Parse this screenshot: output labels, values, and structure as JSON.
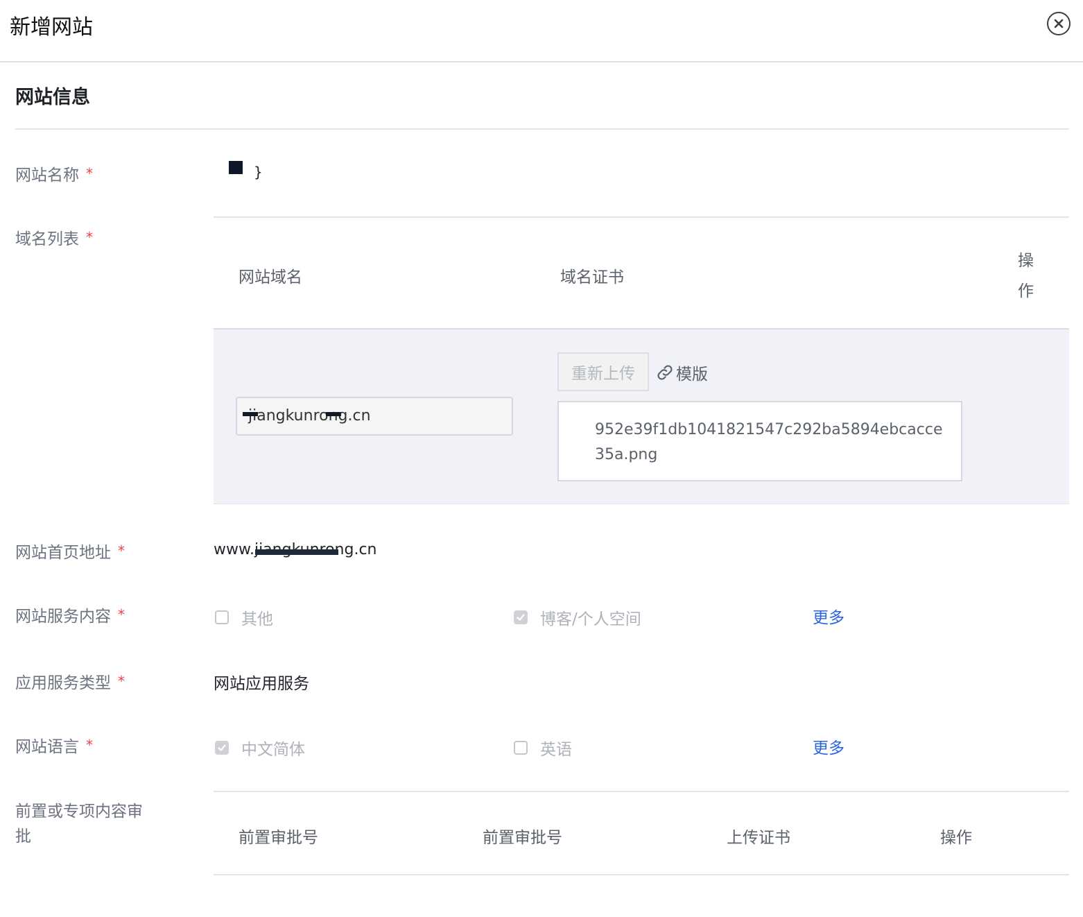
{
  "dialog": {
    "title": "新增网站"
  },
  "section": {
    "title": "网站信息"
  },
  "fields": {
    "site_name": {
      "label": "网站名称",
      "required_mark": "*",
      "value_glyph": "}"
    },
    "domain_list": {
      "label": "域名列表",
      "required_mark": "*",
      "columns": {
        "domain": "网站域名",
        "certificate": "域名证书",
        "ops_line1": "操",
        "ops_line2": "作"
      },
      "rows": [
        {
          "domain": "jiangkunrong.cn",
          "reupload_label": "重新上传",
          "template_label": "模版",
          "file_name": "952e39f1db1041821547c292ba5894ebcacce35a.png"
        }
      ]
    },
    "homepage": {
      "label": "网站首页地址",
      "required_mark": "*",
      "value": "www.jiangkunrong.cn"
    },
    "service_content": {
      "label": "网站服务内容",
      "required_mark": "*",
      "options": [
        {
          "label": "其他",
          "checked": false
        },
        {
          "label": "博客/个人空间",
          "checked": true
        }
      ],
      "more": "更多"
    },
    "app_service_type": {
      "label": "应用服务类型",
      "required_mark": "*",
      "value": "网站应用服务"
    },
    "language": {
      "label": "网站语言",
      "required_mark": "*",
      "options": [
        {
          "label": "中文简体",
          "checked": true
        },
        {
          "label": "英语",
          "checked": false
        }
      ],
      "more": "更多"
    },
    "approval": {
      "label_line1": "前置或专项内容审",
      "label_line2": "批",
      "columns": [
        "前置审批号",
        "前置审批号",
        "上传证书",
        "操作"
      ]
    }
  },
  "icons": {
    "close": "close-circle-icon",
    "link": "link-icon",
    "check": "check-icon"
  },
  "colors": {
    "required": "#e54545",
    "link": "#2b63e1",
    "row_bg": "#f0f2f8"
  }
}
